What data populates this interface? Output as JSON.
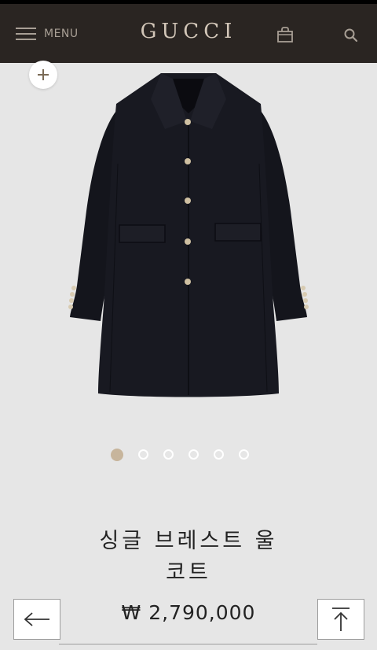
{
  "header": {
    "menu_label": "MENU",
    "logo_text": "GUCCI",
    "icons": [
      "hamburger-menu-icon",
      "shopping-bag-icon",
      "search-icon"
    ],
    "background_color": "#2a2522",
    "logo_color": "#d2c6b8"
  },
  "gallery": {
    "zoom_icon": "plus-icon",
    "image_alt": "black single-breasted wool coat",
    "image_count": 6,
    "active_index": 0,
    "active_color": "#c7b59c"
  },
  "product": {
    "title": "싱글 브레스트 울 코트",
    "price": "₩ 2,790,000"
  },
  "navigation": {
    "back_icon": "arrow-left-icon",
    "top_icon": "arrow-up-to-top-icon"
  }
}
